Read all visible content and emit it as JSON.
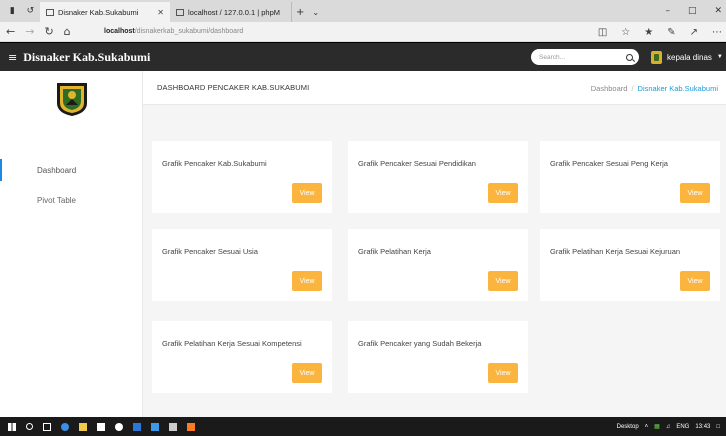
{
  "browser": {
    "tabs": [
      {
        "label": "Disnaker Kab.Sukabumi",
        "active": true
      },
      {
        "label": "localhost / 127.0.0.1 | phpM",
        "active": false
      }
    ],
    "address": {
      "host": "localhost",
      "path": "/disnakerkab_sukabumi/dashboard"
    }
  },
  "navbar": {
    "brand": "Disnaker Kab.Sukabumi",
    "search_placeholder": "Search...",
    "user": "kepala dinas"
  },
  "sidebar": {
    "items": [
      {
        "label": "Dashboard",
        "active": true
      },
      {
        "label": "Pivot Table",
        "active": false
      }
    ]
  },
  "header": {
    "title": "DASHBOARD PENCAKER KAB.SUKABUMI",
    "breadcrumb": [
      "Dashboard",
      "Disnaker Kab.Sukabumi"
    ],
    "breadcrumb_sep": "/"
  },
  "cards": [
    {
      "title": "Grafik Pencaker Kab.Sukabumi",
      "button": "View"
    },
    {
      "title": "Grafik Pencaker Sesuai Pendidikan",
      "button": "View"
    },
    {
      "title": "Grafik Pencaker Sesuai Peng Kerja",
      "button": "View"
    },
    {
      "title": "Grafik Pencaker Sesuai Usia",
      "button": "View"
    },
    {
      "title": "Grafik Pelatihan Kerja",
      "button": "View"
    },
    {
      "title": "Grafik Pelatihan Kerja Sesuai Kejuruan",
      "button": "View"
    },
    {
      "title": "Grafik Pelatihan Kerja Sesuai Kompetensi",
      "button": "View"
    },
    {
      "title": "Grafik Pencaker yang Sudah Bekerja",
      "button": "View"
    }
  ],
  "taskbar": {
    "desktop_label": "Desktop",
    "lang": "ENG",
    "time": "13:43"
  },
  "colors": {
    "accent_button": "#fbb53f",
    "navbar_bg": "#2b2b2b",
    "link": "#1e9bd7",
    "sidebar_active_border": "#1e88e5"
  }
}
